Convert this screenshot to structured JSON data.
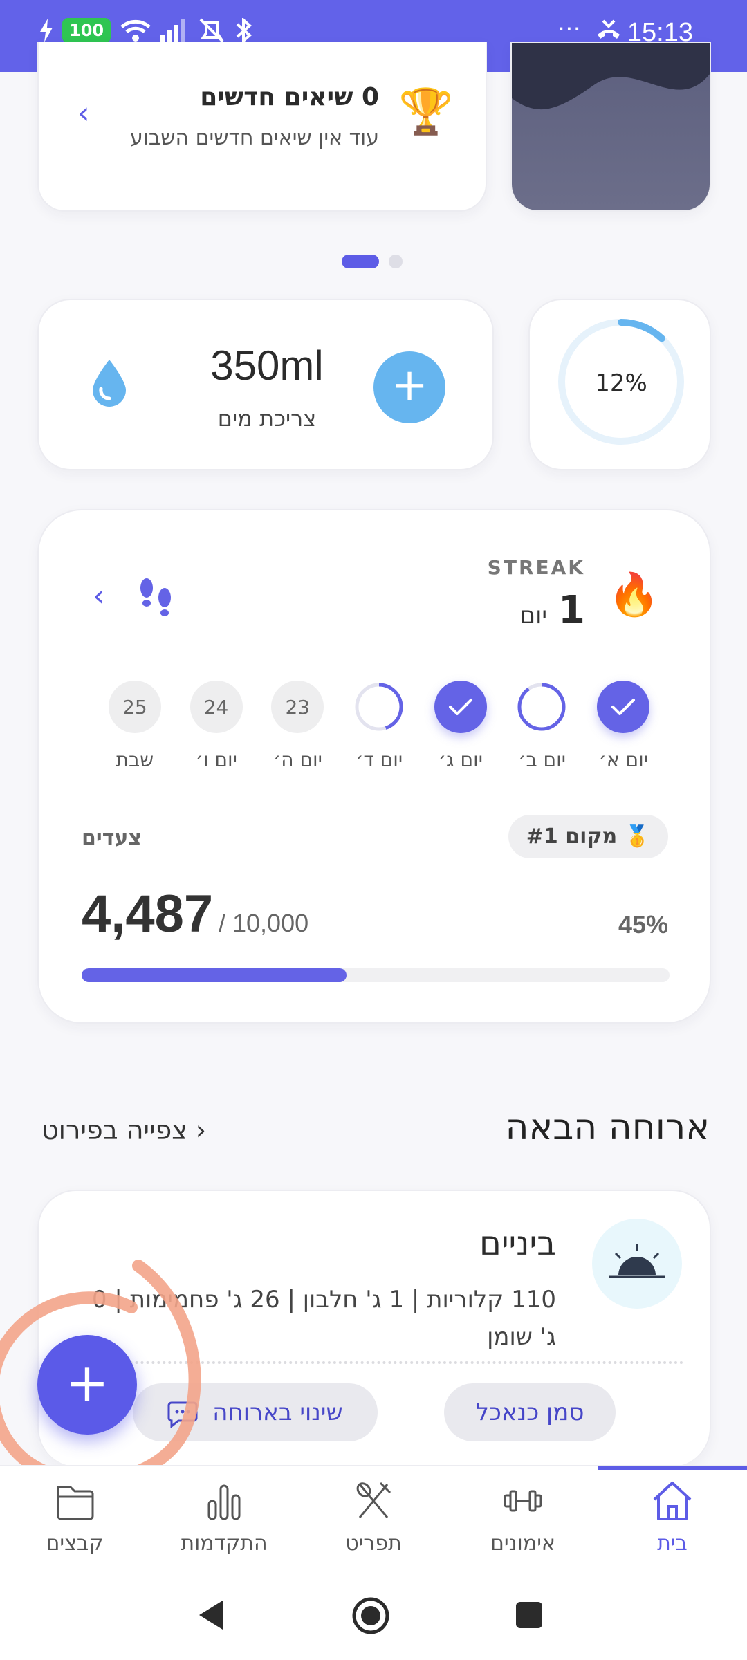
{
  "status_bar": {
    "battery": "100",
    "time": "15:13",
    "more": "···"
  },
  "challenge": {
    "title": "0 שיאים חדשים",
    "subtitle": "עוד אין שיאים חדשים השבוע"
  },
  "water": {
    "amount": "350ml",
    "label": "צריכת מים"
  },
  "ring": {
    "percent_label": "12%",
    "fraction": 0.12
  },
  "streak": {
    "label": "STREAK",
    "count": "1",
    "unit": "יום",
    "days": [
      {
        "name": "יום א׳",
        "state": "done",
        "num": ""
      },
      {
        "name": "יום ב׳",
        "state": "partial",
        "num": "",
        "fraction": 0.9
      },
      {
        "name": "יום ג׳",
        "state": "done",
        "num": ""
      },
      {
        "name": "יום ד׳",
        "state": "partial",
        "num": "",
        "fraction": 0.45
      },
      {
        "name": "יום ה׳",
        "state": "future",
        "num": "23"
      },
      {
        "name": "יום ו׳",
        "state": "future",
        "num": "24"
      },
      {
        "name": "שבת",
        "state": "future",
        "num": "25"
      }
    ]
  },
  "steps": {
    "label": "צעדים",
    "rank": "🥇 מקום #1",
    "value": "4,487",
    "goal": "/ 10,000",
    "percent": "45%",
    "fraction": 0.45
  },
  "next_meal": {
    "title": "ארוחה הבאה",
    "view_details": "צפייה בפירוט",
    "name": "ביניים",
    "macros": "110 קלוריות | 1 ג' חלבון | 26 ג' פחמימות | 0 ג' שומן",
    "mark_eaten": "סמן כנאכל",
    "change_meal": "שינוי בארוחה"
  },
  "bottom_nav": [
    {
      "label": "בית",
      "icon": "home-icon",
      "active": true
    },
    {
      "label": "אימונים",
      "icon": "dumbbell-icon",
      "active": false
    },
    {
      "label": "תפריט",
      "icon": "utensils-icon",
      "active": false
    },
    {
      "label": "התקדמות",
      "icon": "bar-chart-icon",
      "active": false
    },
    {
      "label": "קבצים",
      "icon": "folder-icon",
      "active": false
    }
  ],
  "colors": {
    "primary": "#5d5ce6",
    "status_bar": "#6262e9",
    "water_blue": "#66b5ef"
  }
}
